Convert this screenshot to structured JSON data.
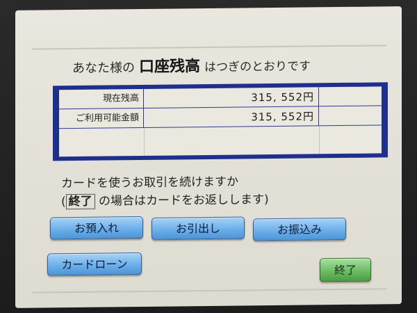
{
  "header": {
    "title_prefix": "あなた様の",
    "title_main": "口座残高",
    "title_suffix": "はつぎのとおりです"
  },
  "balance_table": {
    "rows": [
      {
        "label": "現在残高",
        "value": "315, 552円"
      },
      {
        "label": "ご利用可能金額",
        "value": "315, 552円"
      }
    ]
  },
  "prompt": {
    "line1": "カードを使うお取引を続けますか",
    "line2_open": "(",
    "line2_boxed": "終了",
    "line2_rest": " の場合はカードをお返しします)"
  },
  "buttons": {
    "deposit": "お預入れ",
    "withdraw": "お引出し",
    "transfer": "お振込み",
    "card_loan": "カードローン",
    "finish": "終了"
  },
  "colors": {
    "table_border": "#1f2f8e",
    "button_blue": "#6cb0ea",
    "button_green": "#6dbd63"
  }
}
